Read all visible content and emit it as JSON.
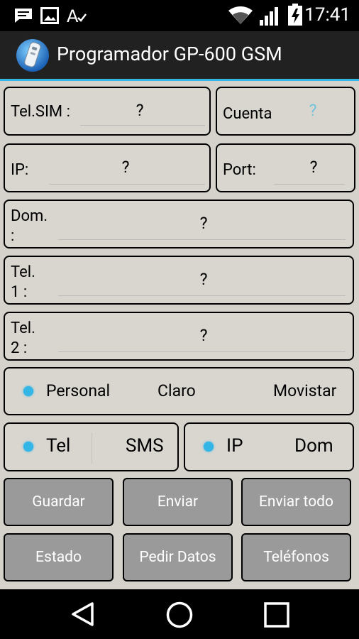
{
  "status_bar": {
    "time": "17:41"
  },
  "app": {
    "title": "Programador GP-600 GSM"
  },
  "fields": {
    "tel_sim": {
      "label": "Tel.SIM :",
      "value": "?"
    },
    "cuenta": {
      "label": "Cuenta",
      "value": "?"
    },
    "ip": {
      "label": "IP:",
      "value": "?"
    },
    "port": {
      "label": "Port:",
      "value": "?"
    },
    "dom": {
      "label_line1": "Dom.",
      "label_line2": ":",
      "value": "?"
    },
    "tel1": {
      "label_line1": "Tel.",
      "label_line2": "1 :",
      "value": "?"
    },
    "tel2": {
      "label_line1": "Tel.",
      "label_line2": "2 :",
      "value": "?"
    }
  },
  "operator": {
    "options": [
      "Personal",
      "Claro",
      "Movistar"
    ],
    "selected": "Personal"
  },
  "mode1": {
    "options": [
      "Tel",
      "SMS"
    ],
    "selected": "Tel"
  },
  "mode2": {
    "options": [
      "IP",
      "Dom"
    ],
    "selected": "IP"
  },
  "buttons": {
    "guardar": "Guardar",
    "enviar": "Enviar",
    "enviar_todo": "Enviar todo",
    "estado": "Estado",
    "pedir_datos": "Pedir Datos",
    "telefonos": "Teléfonos"
  },
  "colors": {
    "accent": "#33b5e5",
    "action_bar": "#212121",
    "content_bg": "#d5d2cc",
    "button_bg": "#9a9a9a"
  }
}
